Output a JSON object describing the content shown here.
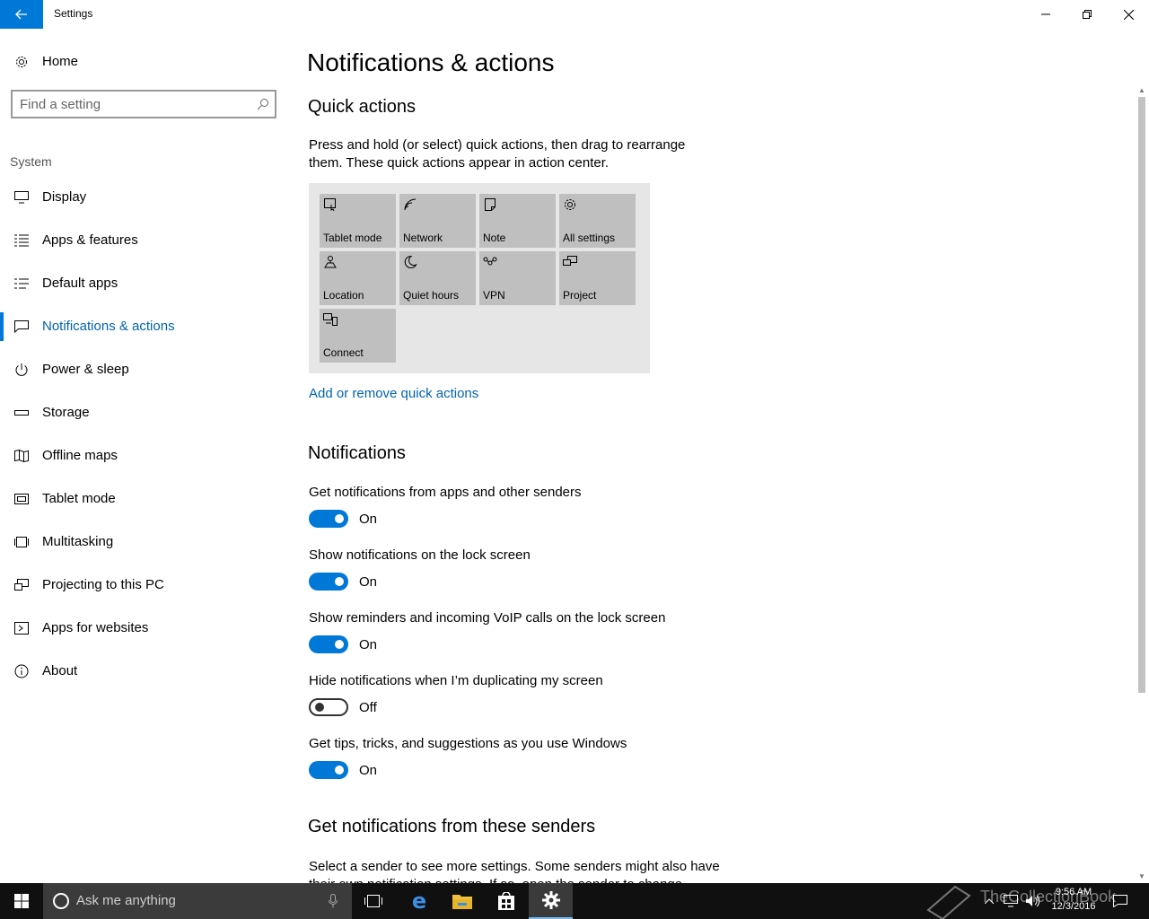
{
  "window": {
    "title": "Settings"
  },
  "sidebar": {
    "home_label": "Home",
    "search_placeholder": "Find a setting",
    "section": "System",
    "items": [
      {
        "label": "Display",
        "icon": "monitor-icon"
      },
      {
        "label": "Apps & features",
        "icon": "list-icon"
      },
      {
        "label": "Default apps",
        "icon": "default-apps-icon"
      },
      {
        "label": "Notifications & actions",
        "icon": "notification-icon",
        "active": true
      },
      {
        "label": "Power & sleep",
        "icon": "power-icon"
      },
      {
        "label": "Storage",
        "icon": "storage-icon"
      },
      {
        "label": "Offline maps",
        "icon": "map-icon"
      },
      {
        "label": "Tablet mode",
        "icon": "tablet-icon"
      },
      {
        "label": "Multitasking",
        "icon": "multitasking-icon"
      },
      {
        "label": "Projecting to this PC",
        "icon": "project-icon"
      },
      {
        "label": "Apps for websites",
        "icon": "web-apps-icon"
      },
      {
        "label": "About",
        "icon": "info-icon"
      }
    ]
  },
  "main": {
    "title": "Notifications & actions",
    "quick_actions": {
      "heading": "Quick actions",
      "description": "Press and hold (or select) quick actions, then drag to rearrange them. These quick actions appear in action center.",
      "tiles": [
        {
          "label": "Tablet mode",
          "icon": "tablet-mode-icon"
        },
        {
          "label": "Network",
          "icon": "network-icon"
        },
        {
          "label": "Note",
          "icon": "note-icon"
        },
        {
          "label": "All settings",
          "icon": "gear-icon"
        },
        {
          "label": "Location",
          "icon": "location-icon"
        },
        {
          "label": "Quiet hours",
          "icon": "moon-icon"
        },
        {
          "label": "VPN",
          "icon": "vpn-icon"
        },
        {
          "label": "Project",
          "icon": "project-icon"
        },
        {
          "label": "Connect",
          "icon": "connect-icon"
        }
      ],
      "link": "Add or remove quick actions"
    },
    "notifications": {
      "heading": "Notifications",
      "settings": [
        {
          "label": "Get notifications from apps and other senders",
          "state": "On"
        },
        {
          "label": "Show notifications on the lock screen",
          "state": "On"
        },
        {
          "label": "Show reminders and incoming VoIP calls on the lock screen",
          "state": "On"
        },
        {
          "label": "Hide notifications when I’m duplicating my screen",
          "state": "Off"
        },
        {
          "label": "Get tips, tricks, and suggestions as you use Windows",
          "state": "On"
        }
      ]
    },
    "senders": {
      "heading": "Get notifications from these senders",
      "description": "Select a sender to see more settings. Some senders might also have their own notification settings. If so, open the sender to change"
    }
  },
  "taskbar": {
    "search_placeholder": "Ask me anything",
    "time": "9:56 AM",
    "date": "12/3/2016",
    "watermark": "TheCollectionBook"
  },
  "colors": {
    "accent": "#0078d7",
    "link": "#0063b1",
    "tile": "#bfbfbf",
    "tile_panel": "#e6e6e6",
    "taskbar": "#101010"
  }
}
